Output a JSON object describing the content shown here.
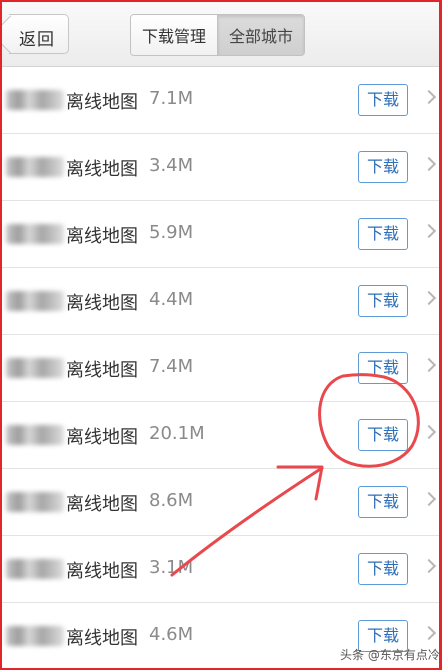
{
  "header": {
    "back_label": "返回",
    "tabs": [
      {
        "label": "下载管理",
        "active": false
      },
      {
        "label": "全部城市",
        "active": true
      }
    ]
  },
  "list": {
    "items": [
      {
        "title": "离线地图",
        "size": "7.1M",
        "button": "下载"
      },
      {
        "title": "离线地图",
        "size": "3.4M",
        "button": "下载"
      },
      {
        "title": "离线地图",
        "size": "5.9M",
        "button": "下载"
      },
      {
        "title": "离线地图",
        "size": "4.4M",
        "button": "下载"
      },
      {
        "title": "离线地图",
        "size": "7.4M",
        "button": "下载"
      },
      {
        "title": "离线地图",
        "size": "20.1M",
        "button": "下载"
      },
      {
        "title": "离线地图",
        "size": "8.6M",
        "button": "下载"
      },
      {
        "title": "离线地图",
        "size": "3.1M",
        "button": "下载"
      },
      {
        "title": "离线地图",
        "size": "4.6M",
        "button": "下载"
      }
    ]
  },
  "watermark": "头条 @东京有点冷",
  "colors": {
    "annotation": "#e8494d",
    "frame": "#e0262b",
    "button_border": "#5f9bd6",
    "button_text": "#2d6fb8"
  }
}
